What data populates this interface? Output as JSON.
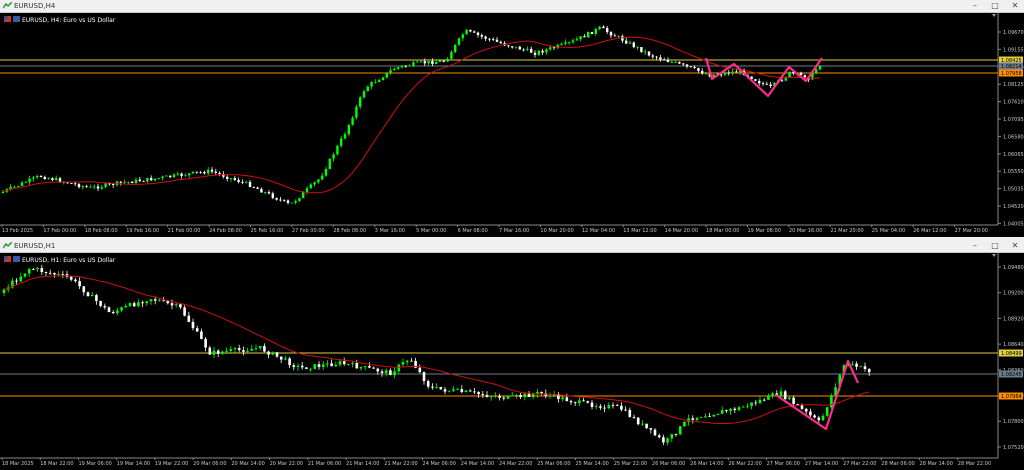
{
  "windows": [
    {
      "id": "h4",
      "title": "EURUSD,H4",
      "legend": "EURUSD, H4:  Euro vs US Dollar",
      "price_labels": [
        "1.09670",
        "1.09155",
        "1.08640",
        "1.08125",
        "1.07610",
        "1.07095",
        "1.06580",
        "1.06065",
        "1.05550",
        "1.05035",
        "1.04520",
        "1.04005"
      ],
      "levels": [
        {
          "label": "1.08425",
          "color": "#e0d040",
          "text_color": "#000000"
        },
        {
          "label": "1.08214",
          "color": "#6b7b8b",
          "text_color": "#000000"
        },
        {
          "label": "1.07958",
          "color": "#ff8c00",
          "text_color": "#000000"
        }
      ],
      "time_labels": [
        "13 Feb 2025",
        "17 Feb 00:00",
        "18 Feb 08:00",
        "19 Feb 16:00",
        "21 Feb 00:00",
        "24 Feb 08:00",
        "25 Feb 16:00",
        "27 Feb 00:00",
        "28 Feb 08:00",
        "3 Mar 16:00",
        "5 Mar 00:00",
        "6 Mar 08:00",
        "7 Mar 16:00",
        "10 Mar 20:00",
        "12 Mar 04:00",
        "13 Mar 12:00",
        "14 Mar 20:00",
        "18 Mar 00:00",
        "19 Mar 08:00",
        "20 Mar 16:00",
        "21 Mar 20:00",
        "25 Mar 04:00",
        "26 Mar 12:00",
        "27 Mar 20:00"
      ]
    },
    {
      "id": "h1",
      "title": "EURUSD,H1",
      "legend": "EURUSD, H1:  Euro vs US Dollar",
      "price_labels": [
        "1.09480",
        "1.09200",
        "1.08920",
        "1.08640",
        "1.08360",
        "1.08080",
        "1.07800",
        "1.07520",
        "1.07240"
      ],
      "levels": [
        {
          "label": "1.08499",
          "color": "#e0d040",
          "text_color": "#000000"
        },
        {
          "label": "1.08245",
          "color": "#6b7b8b",
          "text_color": "#000000"
        },
        {
          "label": "1.07964",
          "color": "#ff8c00",
          "text_color": "#000000"
        }
      ],
      "time_labels": [
        "18 Mar 2025",
        "18 Mar 22:00",
        "19 Mar 06:00",
        "19 Mar 14:00",
        "19 Mar 22:00",
        "20 Mar 06:00",
        "20 Mar 14:00",
        "20 Mar 22:00",
        "21 Mar 06:00",
        "21 Mar 14:00",
        "21 Mar 22:00",
        "24 Mar 06:00",
        "24 Mar 14:00",
        "24 Mar 22:00",
        "25 Mar 06:00",
        "25 Mar 14:00",
        "25 Mar 22:00",
        "26 Mar 06:00",
        "26 Mar 14:00",
        "26 Mar 22:00",
        "27 Mar 06:00",
        "27 Mar 14:00",
        "27 Mar 22:00",
        "28 Mar 06:00",
        "28 Mar 14:00",
        "28 Mar 22:00"
      ]
    }
  ],
  "colors": {
    "bull_candle": "#00ff00",
    "bear_candle": "#ffffff",
    "moving_average": "#d01010",
    "zigzag": "#ff2a8a",
    "axis_text": "#c8c8c8"
  }
}
